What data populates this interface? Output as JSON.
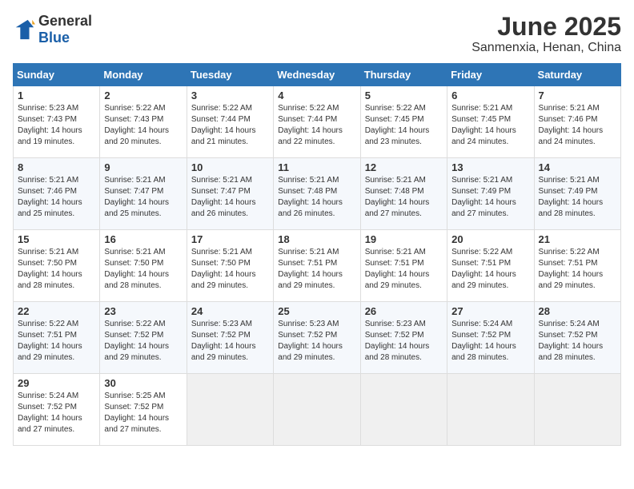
{
  "logo": {
    "general": "General",
    "blue": "Blue"
  },
  "title": "June 2025",
  "subtitle": "Sanmenxia, Henan, China",
  "headers": [
    "Sunday",
    "Monday",
    "Tuesday",
    "Wednesday",
    "Thursday",
    "Friday",
    "Saturday"
  ],
  "weeks": [
    [
      {
        "day": "1",
        "sunrise": "5:23 AM",
        "sunset": "7:43 PM",
        "daylight": "14 hours and 19 minutes."
      },
      {
        "day": "2",
        "sunrise": "5:22 AM",
        "sunset": "7:43 PM",
        "daylight": "14 hours and 20 minutes."
      },
      {
        "day": "3",
        "sunrise": "5:22 AM",
        "sunset": "7:44 PM",
        "daylight": "14 hours and 21 minutes."
      },
      {
        "day": "4",
        "sunrise": "5:22 AM",
        "sunset": "7:44 PM",
        "daylight": "14 hours and 22 minutes."
      },
      {
        "day": "5",
        "sunrise": "5:22 AM",
        "sunset": "7:45 PM",
        "daylight": "14 hours and 23 minutes."
      },
      {
        "day": "6",
        "sunrise": "5:21 AM",
        "sunset": "7:45 PM",
        "daylight": "14 hours and 24 minutes."
      },
      {
        "day": "7",
        "sunrise": "5:21 AM",
        "sunset": "7:46 PM",
        "daylight": "14 hours and 24 minutes."
      }
    ],
    [
      {
        "day": "8",
        "sunrise": "5:21 AM",
        "sunset": "7:46 PM",
        "daylight": "14 hours and 25 minutes."
      },
      {
        "day": "9",
        "sunrise": "5:21 AM",
        "sunset": "7:47 PM",
        "daylight": "14 hours and 25 minutes."
      },
      {
        "day": "10",
        "sunrise": "5:21 AM",
        "sunset": "7:47 PM",
        "daylight": "14 hours and 26 minutes."
      },
      {
        "day": "11",
        "sunrise": "5:21 AM",
        "sunset": "7:48 PM",
        "daylight": "14 hours and 26 minutes."
      },
      {
        "day": "12",
        "sunrise": "5:21 AM",
        "sunset": "7:48 PM",
        "daylight": "14 hours and 27 minutes."
      },
      {
        "day": "13",
        "sunrise": "5:21 AM",
        "sunset": "7:49 PM",
        "daylight": "14 hours and 27 minutes."
      },
      {
        "day": "14",
        "sunrise": "5:21 AM",
        "sunset": "7:49 PM",
        "daylight": "14 hours and 28 minutes."
      }
    ],
    [
      {
        "day": "15",
        "sunrise": "5:21 AM",
        "sunset": "7:50 PM",
        "daylight": "14 hours and 28 minutes."
      },
      {
        "day": "16",
        "sunrise": "5:21 AM",
        "sunset": "7:50 PM",
        "daylight": "14 hours and 28 minutes."
      },
      {
        "day": "17",
        "sunrise": "5:21 AM",
        "sunset": "7:50 PM",
        "daylight": "14 hours and 29 minutes."
      },
      {
        "day": "18",
        "sunrise": "5:21 AM",
        "sunset": "7:51 PM",
        "daylight": "14 hours and 29 minutes."
      },
      {
        "day": "19",
        "sunrise": "5:21 AM",
        "sunset": "7:51 PM",
        "daylight": "14 hours and 29 minutes."
      },
      {
        "day": "20",
        "sunrise": "5:22 AM",
        "sunset": "7:51 PM",
        "daylight": "14 hours and 29 minutes."
      },
      {
        "day": "21",
        "sunrise": "5:22 AM",
        "sunset": "7:51 PM",
        "daylight": "14 hours and 29 minutes."
      }
    ],
    [
      {
        "day": "22",
        "sunrise": "5:22 AM",
        "sunset": "7:51 PM",
        "daylight": "14 hours and 29 minutes."
      },
      {
        "day": "23",
        "sunrise": "5:22 AM",
        "sunset": "7:52 PM",
        "daylight": "14 hours and 29 minutes."
      },
      {
        "day": "24",
        "sunrise": "5:23 AM",
        "sunset": "7:52 PM",
        "daylight": "14 hours and 29 minutes."
      },
      {
        "day": "25",
        "sunrise": "5:23 AM",
        "sunset": "7:52 PM",
        "daylight": "14 hours and 29 minutes."
      },
      {
        "day": "26",
        "sunrise": "5:23 AM",
        "sunset": "7:52 PM",
        "daylight": "14 hours and 28 minutes."
      },
      {
        "day": "27",
        "sunrise": "5:24 AM",
        "sunset": "7:52 PM",
        "daylight": "14 hours and 28 minutes."
      },
      {
        "day": "28",
        "sunrise": "5:24 AM",
        "sunset": "7:52 PM",
        "daylight": "14 hours and 28 minutes."
      }
    ],
    [
      {
        "day": "29",
        "sunrise": "5:24 AM",
        "sunset": "7:52 PM",
        "daylight": "14 hours and 27 minutes."
      },
      {
        "day": "30",
        "sunrise": "5:25 AM",
        "sunset": "7:52 PM",
        "daylight": "14 hours and 27 minutes."
      },
      null,
      null,
      null,
      null,
      null
    ]
  ]
}
